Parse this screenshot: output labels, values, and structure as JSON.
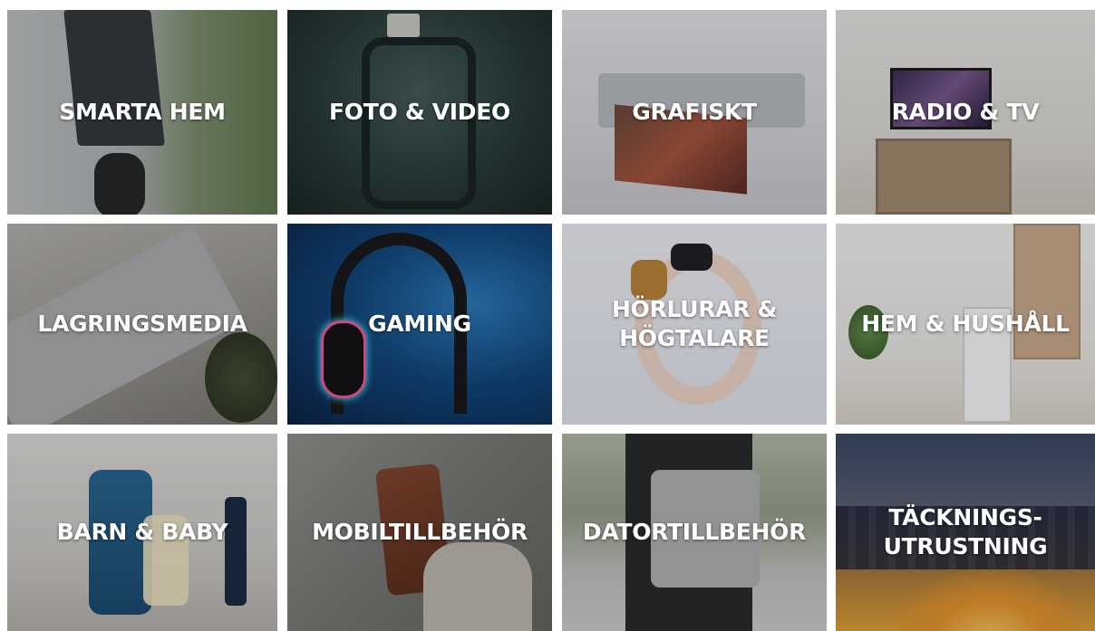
{
  "categories": [
    {
      "id": "smarta-hem",
      "lines": [
        "SMARTA HEM"
      ]
    },
    {
      "id": "foto-video",
      "lines": [
        "FOTO & VIDEO"
      ]
    },
    {
      "id": "grafiskt",
      "lines": [
        "GRAFISKT"
      ]
    },
    {
      "id": "radio-tv",
      "lines": [
        "RADIO & TV"
      ]
    },
    {
      "id": "lagringsmedia",
      "lines": [
        "LAGRINGSMEDIA"
      ]
    },
    {
      "id": "gaming",
      "lines": [
        "GAMING"
      ]
    },
    {
      "id": "horlurar-hogtalare",
      "lines": [
        "HÖRLURAR &",
        "HÖGTALARE"
      ]
    },
    {
      "id": "hem-hushall",
      "lines": [
        "HEM & HUSHÅLL"
      ]
    },
    {
      "id": "barn-baby",
      "lines": [
        "BARN & BABY"
      ]
    },
    {
      "id": "mobiltillbehor",
      "lines": [
        "MOBILTILLBEHÖR"
      ]
    },
    {
      "id": "datortillbehor",
      "lines": [
        "DATORTILLBEHÖR"
      ]
    },
    {
      "id": "tacknings-utrustning",
      "lines": [
        "TÄCKNINGS-",
        "UTRUSTNING"
      ]
    }
  ],
  "colors": {
    "label_text": "#ffffff",
    "page_background": "#ffffff"
  }
}
